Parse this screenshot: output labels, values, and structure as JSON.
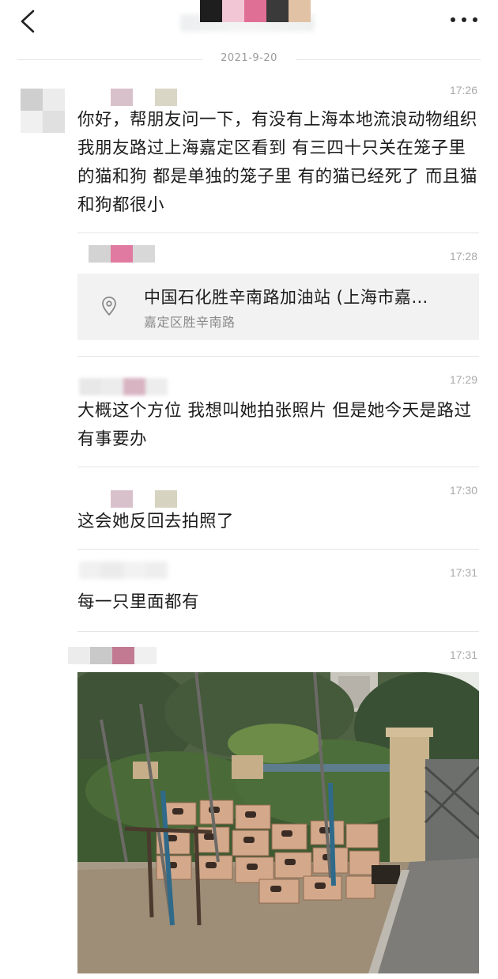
{
  "header": {
    "title": "",
    "back_icon": "chevron-left-icon",
    "more_icon": "more-dots-icon"
  },
  "date_separator": "2021-9-20",
  "messages": [
    {
      "time": "17:26",
      "text": "你好，帮朋友问一下，有没有上海本地流浪动物组织 我朋友路过上海嘉定区看到 有三四十只关在笼子里的猫和狗 都是单独的笼子里 有的猫已经死了 而且猫和狗都很小"
    },
    {
      "time": "17:28",
      "location": {
        "name": "中国石化胜辛南路加油站 (上海市嘉…",
        "address": "嘉定区胜辛南路"
      }
    },
    {
      "time": "17:29",
      "text": "大概这个方位 我想叫她拍张照片 但是她今天是路过有事要办"
    },
    {
      "time": "17:30",
      "text": "这会她反回去拍照了"
    },
    {
      "time": "17:31",
      "text": "每一只里面都有"
    },
    {
      "time": "17:31",
      "image": "photo of stacked cardboard cat boxes beside bushes and a fence"
    }
  ],
  "colors": {
    "time_text": "#a9a9a9",
    "location_card_bg": "#f2f2f2",
    "divider": "#e5e5e5"
  }
}
